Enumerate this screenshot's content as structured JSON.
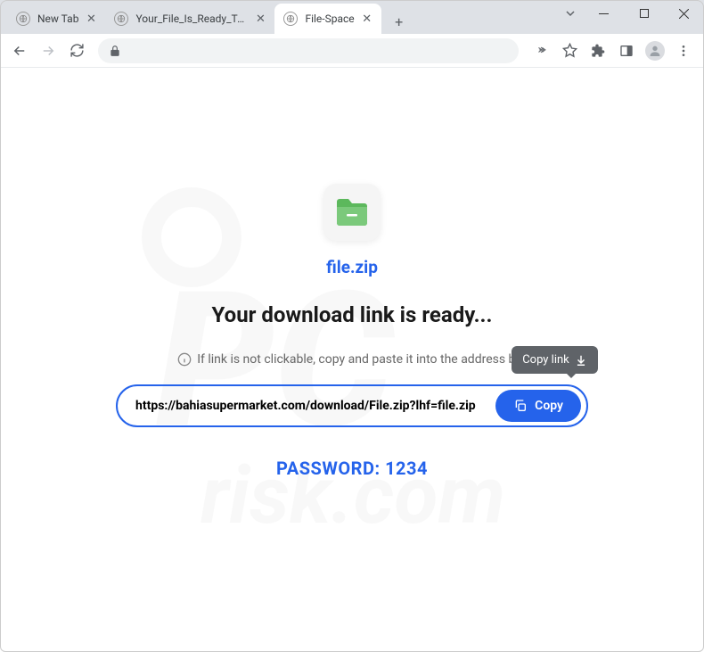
{
  "window": {
    "tabs": [
      {
        "title": "New Tab"
      },
      {
        "title": "Your_File_Is_Ready_To_Downl"
      },
      {
        "title": "File-Space"
      }
    ],
    "activeTab": 2
  },
  "page": {
    "filename": "file.zip",
    "heading": "Your download link is ready...",
    "hint": "If link is not clickable, copy and paste it into the address bar",
    "tooltip": "Copy link",
    "downloadUrl": "https://bahiasupermarket.com/download/File.zip?lhf=file.zip",
    "copyButton": "Copy",
    "passwordLabel": "PASSWORD: 1234"
  },
  "icons": {
    "globe": "globe-icon",
    "folder": "folder-icon",
    "info": "info-icon",
    "download": "download-icon",
    "copy": "copy-icon"
  },
  "colors": {
    "accent": "#2563eb",
    "tabbar": "#dee1e6",
    "tooltip": "#5f6368"
  }
}
